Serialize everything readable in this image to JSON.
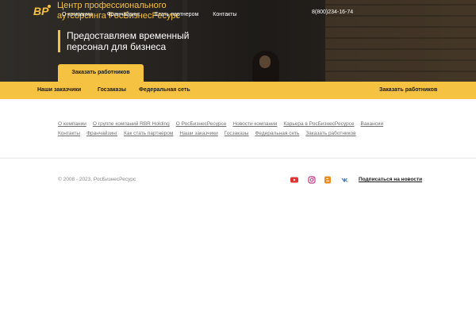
{
  "header": {
    "logo_text": "BP",
    "company_name": "Центр профессионального аутсорсинга РосБизнесРесурс",
    "nav": [
      "О компании",
      "Франчайзинг",
      "Стать партнером",
      "Контакты"
    ],
    "phone": "8(800)234-16-74"
  },
  "hero": {
    "tagline": "Предоставляем временный персонал для бизнеса",
    "cta_label": "Заказать работников"
  },
  "subnav": {
    "items": [
      "Наши заказчики",
      "Госзаказы",
      "Федеральная сеть"
    ],
    "right_item": "Заказать работников"
  },
  "footer_links": {
    "row1": [
      "О компании",
      "О группе компаний RBR Holding",
      "О РосБизнесРесурсе",
      "Новости компании",
      "Карьера в РосБизнесРесурсе",
      "Вакансии"
    ],
    "row2": [
      "Контакты",
      "Франчайзинг",
      "Как стать партнером",
      "Наши заказчики",
      "Госзаказы",
      "Федеральная сеть",
      "Заказать работников"
    ]
  },
  "footer": {
    "copyright": "© 2008 - 2023, РосБизнесРесурс",
    "social_icons": [
      "youtube-icon",
      "instagram-icon",
      "blogger-icon",
      "vk-icon"
    ],
    "subscribe_label": "Подписаться на новости"
  },
  "colors": {
    "accent": "#f5c242",
    "youtube": "#e0312e",
    "instagram": "#c13584",
    "blogger": "#f08c1e",
    "vk": "#4a76a8"
  }
}
